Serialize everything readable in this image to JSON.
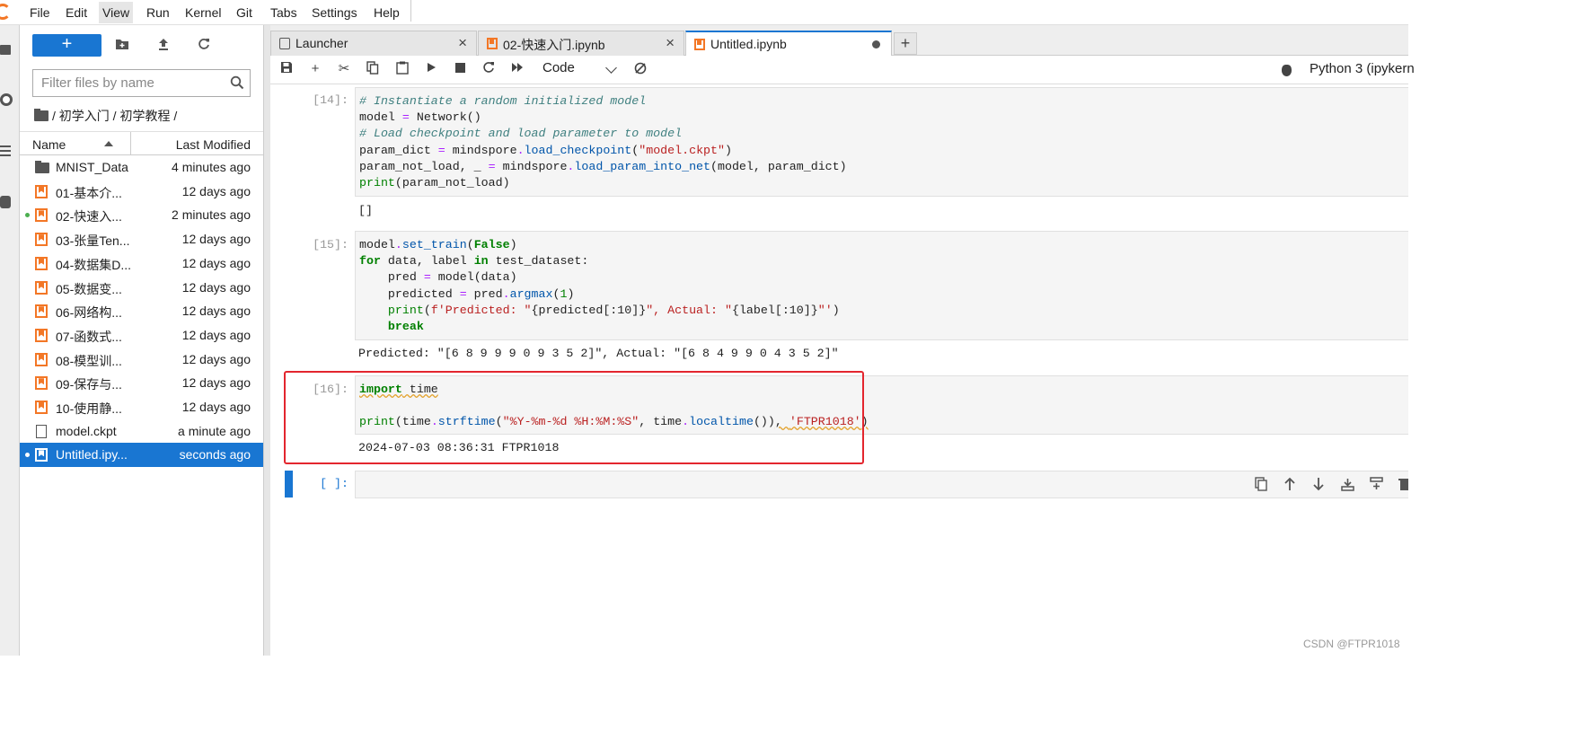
{
  "menubar": {
    "items": [
      "File",
      "Edit",
      "View",
      "Run",
      "Kernel",
      "Git",
      "Tabs",
      "Settings",
      "Help"
    ],
    "active": "View"
  },
  "filebrowser": {
    "new_label": "+",
    "filter_placeholder": "Filter files by name",
    "breadcrumb": "/ 初学入门 / 初学教程 /",
    "col_name": "Name",
    "col_modified": "Last Modified",
    "files": [
      {
        "name": "MNIST_Data",
        "modified": "4 minutes ago",
        "type": "folder",
        "running": false,
        "selected": false
      },
      {
        "name": "01-基本介...",
        "modified": "12 days ago",
        "type": "notebook",
        "running": false,
        "selected": false
      },
      {
        "name": "02-快速入...",
        "modified": "2 minutes ago",
        "type": "notebook",
        "running": true,
        "selected": false
      },
      {
        "name": "03-张量Ten...",
        "modified": "12 days ago",
        "type": "notebook",
        "running": false,
        "selected": false
      },
      {
        "name": "04-数据集D...",
        "modified": "12 days ago",
        "type": "notebook",
        "running": false,
        "selected": false
      },
      {
        "name": "05-数据变...",
        "modified": "12 days ago",
        "type": "notebook",
        "running": false,
        "selected": false
      },
      {
        "name": "06-网络构...",
        "modified": "12 days ago",
        "type": "notebook",
        "running": false,
        "selected": false
      },
      {
        "name": "07-函数式...",
        "modified": "12 days ago",
        "type": "notebook",
        "running": false,
        "selected": false
      },
      {
        "name": "08-模型训...",
        "modified": "12 days ago",
        "type": "notebook",
        "running": false,
        "selected": false
      },
      {
        "name": "09-保存与...",
        "modified": "12 days ago",
        "type": "notebook",
        "running": false,
        "selected": false
      },
      {
        "name": "10-使用静...",
        "modified": "12 days ago",
        "type": "notebook",
        "running": false,
        "selected": false
      },
      {
        "name": "model.ckpt",
        "modified": "a minute ago",
        "type": "file",
        "running": false,
        "selected": false
      },
      {
        "name": "Untitled.ipy...",
        "modified": "seconds ago",
        "type": "notebook",
        "running": true,
        "selected": true
      }
    ]
  },
  "tabs": [
    {
      "label": "Launcher",
      "icon": "launcher-icon",
      "current": false,
      "dirty": false
    },
    {
      "label": "02-快速入门.ipynb",
      "icon": "notebook-icon",
      "current": false,
      "dirty": false
    },
    {
      "label": "Untitled.ipynb",
      "icon": "notebook-icon",
      "current": true,
      "dirty": true
    }
  ],
  "add_tab_label": "+",
  "toolbar": {
    "cell_type": "Code",
    "kernel": "Python 3 (ipykern"
  },
  "cells": {
    "c14": {
      "prompt": "[14]:",
      "output": "[]"
    },
    "c15": {
      "prompt": "[15]:",
      "output": "Predicted: \"[6 8 9 9 9 0 9 3 5 2]\", Actual: \"[6 8 4 9 9 0 4 3 5 2]\""
    },
    "c16": {
      "prompt": "[16]:",
      "output": "2024-07-03 08:36:31 FTPR1018"
    },
    "empty": {
      "prompt": "[ ]:"
    }
  },
  "watermark": "CSDN @FTPR1018",
  "colors": {
    "accent": "#1976d2",
    "highlight_box": "#e3262e",
    "notebook_icon": "#f37726"
  }
}
